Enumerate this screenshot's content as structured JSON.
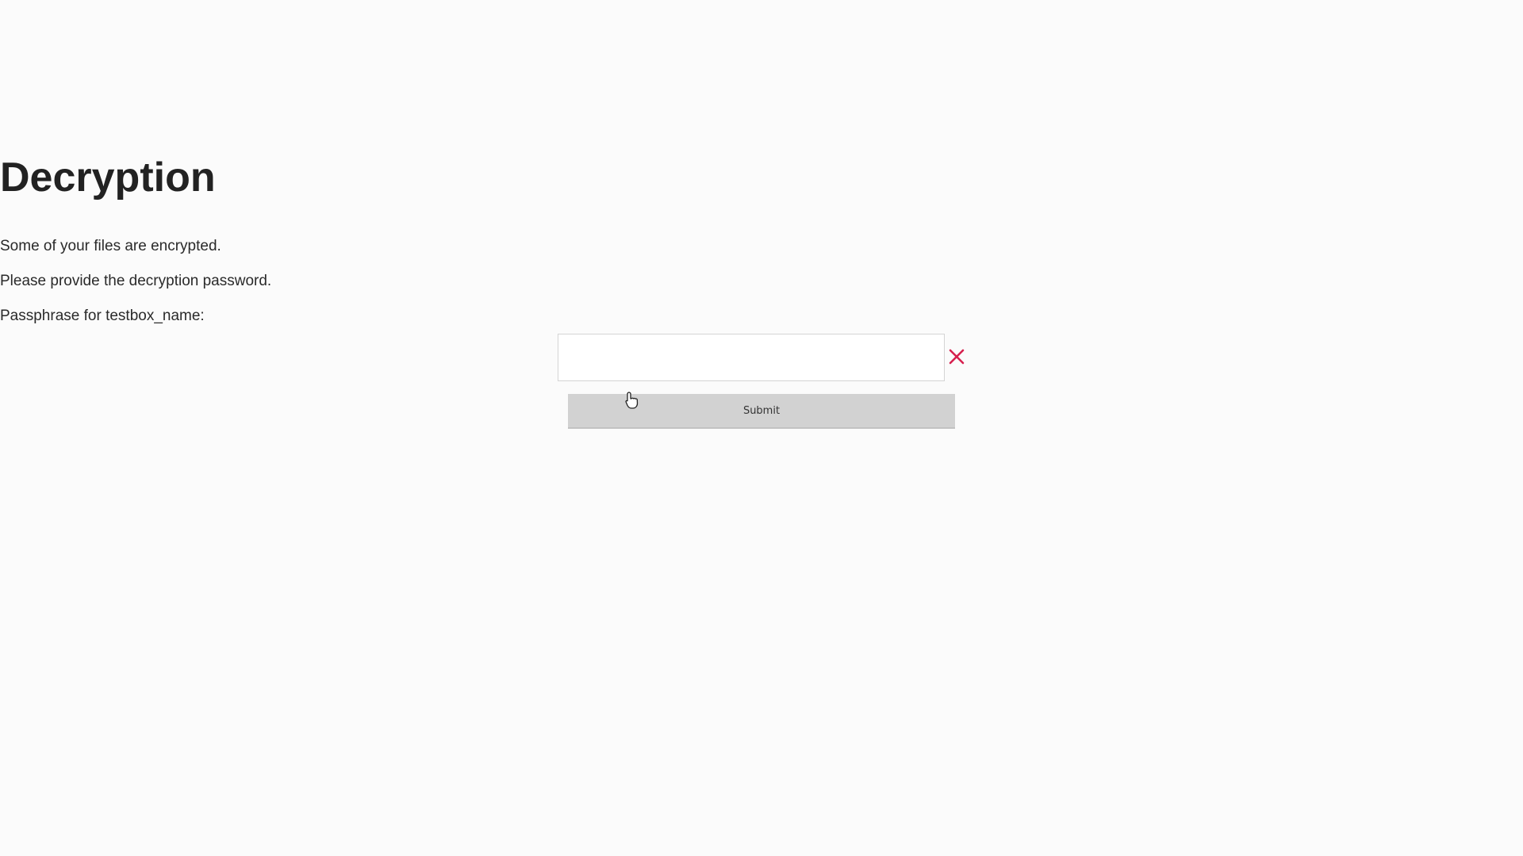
{
  "page": {
    "title": "Decryption",
    "message_line1": "Some of your files are encrypted.",
    "message_line2": "Please provide the decryption password.",
    "passphrase_label": "Passphrase for testbox_name:"
  },
  "form": {
    "passphrase_value": "",
    "passphrase_placeholder": "",
    "clear_icon": "close-icon",
    "submit_label": "Submit"
  },
  "colors": {
    "background": "#fbfbfb",
    "text": "#2a2a2a",
    "clear_icon": "#d6204e",
    "submit_background": "#d2d2d2"
  }
}
